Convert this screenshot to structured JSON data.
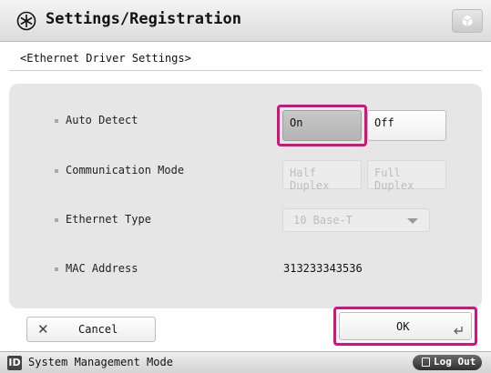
{
  "header": {
    "title": "Settings/Registration"
  },
  "subtitle": "<Ethernet Driver Settings>",
  "rows": {
    "auto_detect": {
      "label": "Auto Detect",
      "on": "On",
      "off": "Off"
    },
    "communication_mode": {
      "label": "Communication Mode",
      "half": "Half Duplex",
      "full": "Full Duplex"
    },
    "ethernet_type": {
      "label": "Ethernet Type",
      "value": "10 Base-T"
    },
    "mac_address": {
      "label": "MAC Address",
      "value": "313233343536"
    }
  },
  "footer": {
    "cancel_label": "Cancel",
    "ok_label": "OK"
  },
  "status": {
    "mode_icon": "ID",
    "mode_text": "System Management Mode",
    "logout_label": "Log Out"
  },
  "colors": {
    "highlight": "#d6127a",
    "panel": "#e6e6e6"
  }
}
